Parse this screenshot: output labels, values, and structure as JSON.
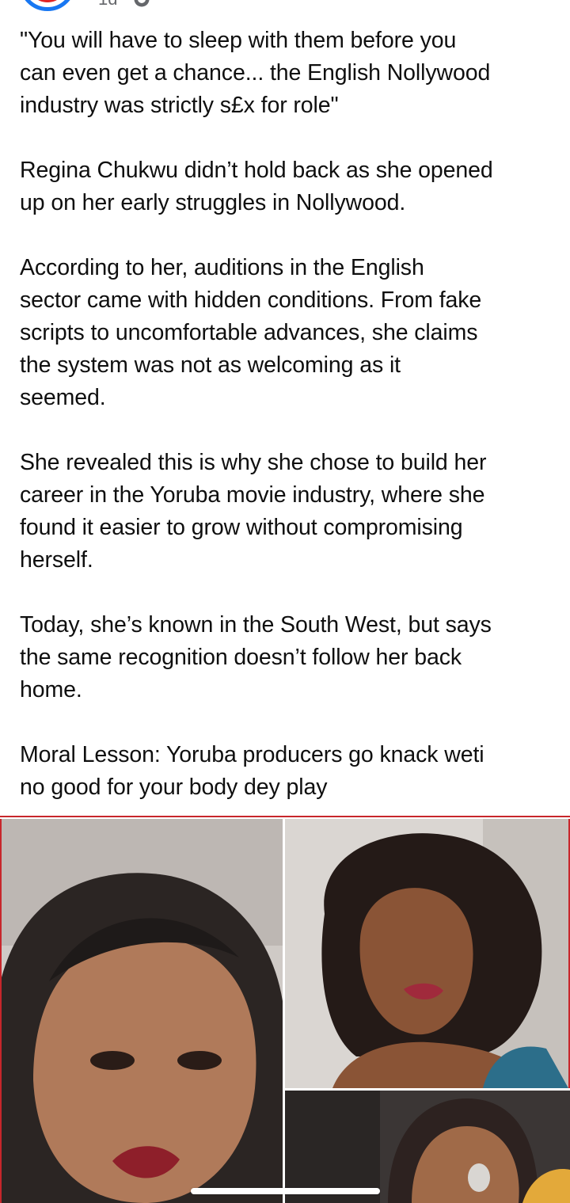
{
  "post": {
    "time": "1d",
    "paragraphs": [
      "\"You will have to sleep with them before you\ncan even get a chance... the English Nollywood\nindustry was strictly s£x for role\"",
      "Regina Chukwu didn’t hold back as she opened\nup on her early struggles in Nollywood.",
      "According to her, auditions in the English\nsector came with hidden conditions. From fake\nscripts to uncomfortable advances, she claims\nthe system was not as welcoming as it\nseemed.",
      "She revealed this is why she chose to build her\ncareer in the Yoruba movie industry, where she\nfound it easier to grow without compromising\nherself.",
      "Today, she’s known in the South West, but says\nthe same recognition doesn’t follow her back\nhome.",
      "Moral Lesson: Yoruba producers go knack weti\nno good for your body dey play"
    ]
  },
  "icons": {
    "page_avatar": "page-avatar-icon",
    "audience": "globe-icon"
  },
  "colors": {
    "avatar_ring": "#1877f2",
    "avatar_fill": "#e02424",
    "frame_border": "#c7262b",
    "meta_text": "#65676b"
  }
}
